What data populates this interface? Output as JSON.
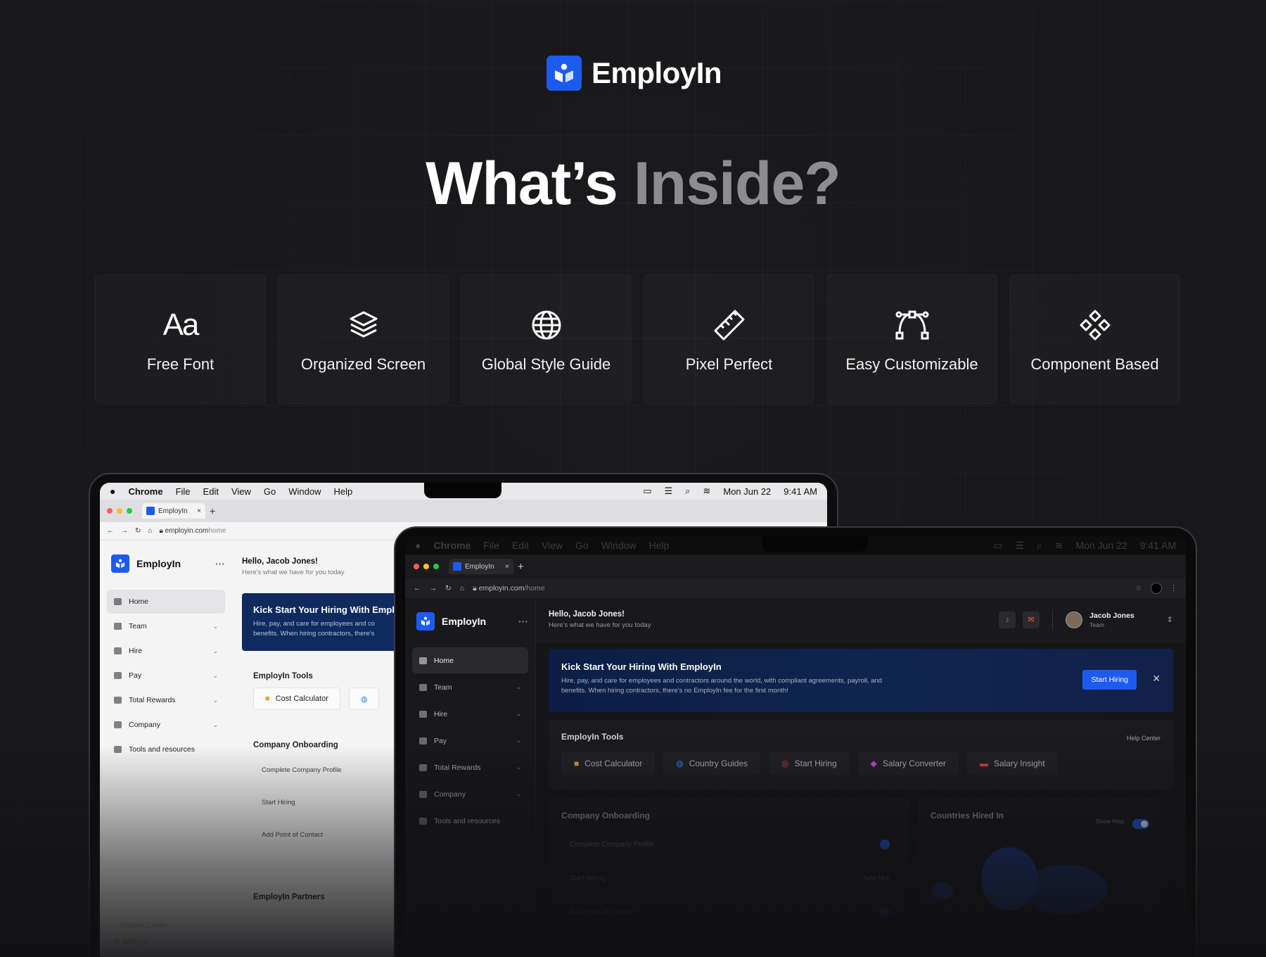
{
  "brand": {
    "name": "EmployIn",
    "color": "#1d5bf0"
  },
  "headline": {
    "part1": "What’s ",
    "part2": "Inside?"
  },
  "features": [
    {
      "icon": "font-aa-icon",
      "label": "Free Font",
      "glyph": "Aa"
    },
    {
      "icon": "layers-icon",
      "label": "Organized Screen"
    },
    {
      "icon": "globe-icon",
      "label": "Global Style Guide"
    },
    {
      "icon": "ruler-icon",
      "label": "Pixel Perfect"
    },
    {
      "icon": "bezier-curve-icon",
      "label": "Easy Customizable"
    },
    {
      "icon": "components-icon",
      "label": "Component Based"
    }
  ],
  "menubar": {
    "app": "Chrome",
    "items": [
      "File",
      "Edit",
      "View",
      "Go",
      "Window",
      "Help"
    ],
    "date": "Mon Jun 22",
    "time": "9:41 AM"
  },
  "light": {
    "tab": "EmployIn",
    "url_domain": "employin.com",
    "url_path": "home",
    "hello": "Hello, Jacob Jones!",
    "hello_sub": "Here’s what we have for you today",
    "nav": [
      "Home",
      "Team",
      "Hire",
      "Pay",
      "Total Rewards",
      "Company",
      "Tools and resources"
    ],
    "banner_title": "Kick Start Your Hiring With Empl",
    "banner_desc_1": "Hire, pay, and care for employees and co",
    "banner_desc_2": "benefits. When hiring contractors, there's",
    "tools_title": "EmployIn Tools",
    "tool_1": "Cost Calculator",
    "onboarding_title": "Company Onboarding",
    "onboarding": [
      "Complete Company Profile",
      "Start Hiring",
      "Add Point of Contact"
    ],
    "partners_title": "EmployIn Partners",
    "support": "Support Center",
    "settings": "Settings"
  },
  "dark": {
    "tab": "EmployIn",
    "url_domain": "employin.com",
    "url_path": "/home",
    "hello": "Hello, Jacob Jones!",
    "hello_sub": "Here’s what we have for you today",
    "user_name": "Jacob Jones",
    "user_role": "Team",
    "nav": [
      "Home",
      "Team",
      "Hire",
      "Pay",
      "Total Rewards",
      "Company",
      "Tools and resources"
    ],
    "banner_title": "Kick Start Your Hiring With EmployIn",
    "banner_desc_1": "Hire, pay, and care for employees and contractors around the world, with compliant agreements, payroll, and",
    "banner_desc_2": "benefits. When hiring contractors, there's no EmployIn fee for the first month!",
    "start_hiring": "Start Hiring",
    "tools_title": "EmployIn Tools",
    "help_center": "Help Center",
    "tools": [
      "Cost Calculator",
      "Country Guides",
      "Start Hiring",
      "Salary Converter",
      "Salary Insight"
    ],
    "onboarding_title": "Company Onboarding",
    "onboarding": [
      "Complete Company Profile",
      "Start Hiring",
      "Add Point of Contact"
    ],
    "new_hire": "New Hire",
    "countries_title": "Countries Hired In",
    "show_map": "Show Map"
  }
}
